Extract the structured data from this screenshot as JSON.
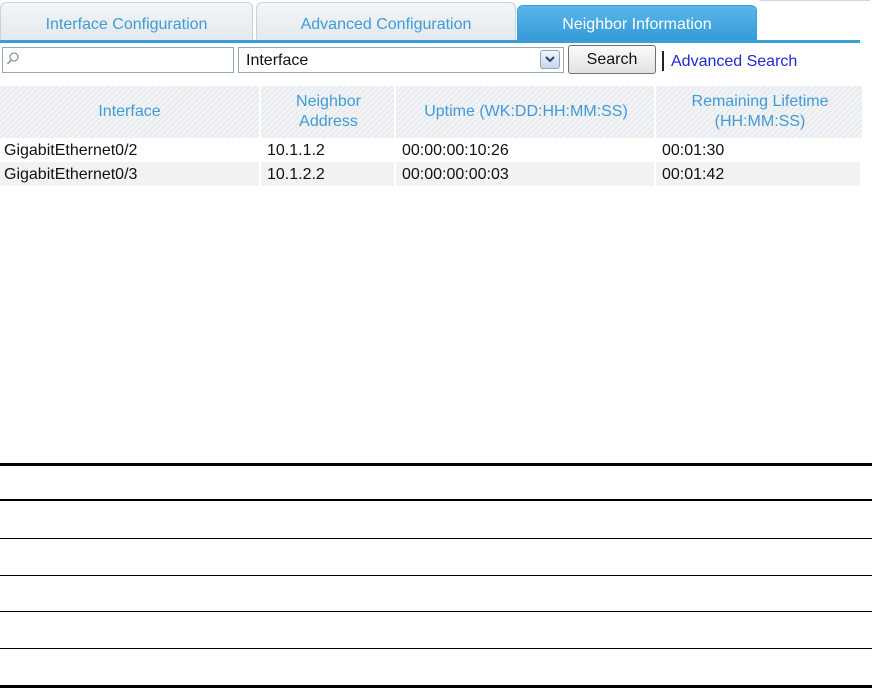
{
  "tabs": [
    {
      "label": "Interface Configuration",
      "active": false
    },
    {
      "label": "Advanced Configuration",
      "active": false
    },
    {
      "label": "Neighbor Information",
      "active": true
    }
  ],
  "search": {
    "query": "",
    "field_selected": "Interface",
    "button_label": "Search",
    "advanced_link": "Advanced Search"
  },
  "table": {
    "columns": [
      "Interface",
      "Neighbor Address",
      "Uptime (WK:DD:HH:MM:SS)",
      "Remaining Lifetime (HH:MM:SS)"
    ],
    "rows": [
      [
        "GigabitEthernet0/2",
        "10.1.1.2",
        "00:00:00:10:26",
        "00:01:30"
      ],
      [
        "GigabitEthernet0/3",
        "10.1.2.2",
        "00:00:00:00:03",
        "00:01:42"
      ]
    ]
  },
  "colors": {
    "accent": "#3b9edb",
    "header_text": "#3f9bd6",
    "link": "#1c2bd0"
  }
}
